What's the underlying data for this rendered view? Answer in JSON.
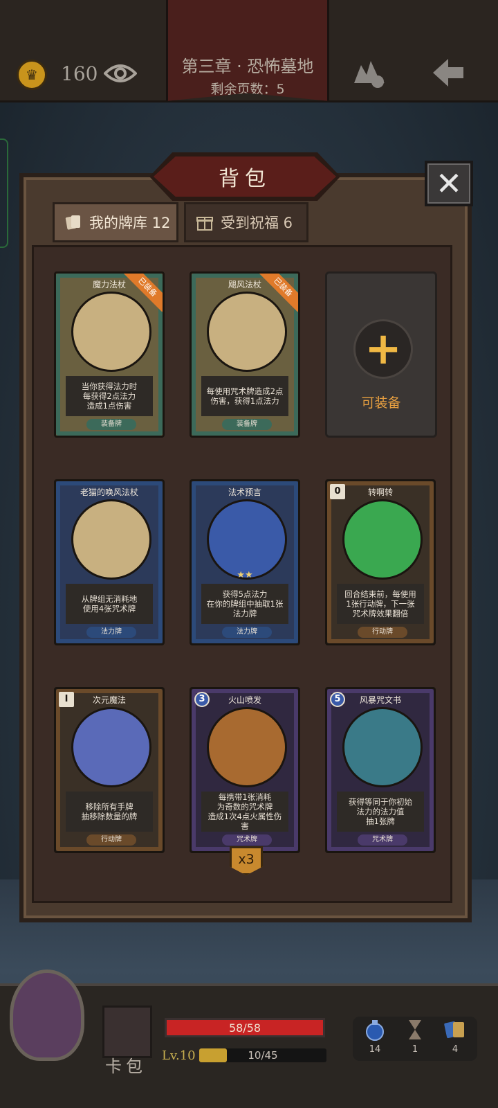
{
  "header": {
    "coins": "160",
    "chapter_title": "第三章 · 恐怖墓地",
    "pages_left": "剩余页数：5"
  },
  "panel": {
    "title": "背包",
    "close_label": "✕",
    "tabs": [
      {
        "label": "我的牌库 12",
        "active": true
      },
      {
        "label": "受到祝福 6",
        "active": false
      }
    ],
    "empty_slot_label": "可装备",
    "equipped_tag": "已装备",
    "stack_badge": "x3"
  },
  "cards": [
    {
      "name": "魔力法杖",
      "desc": "当你获得法力时\n每获得2点法力\n造成1点伤害",
      "type": "装备牌",
      "frame": "#3c6a5a",
      "art": "#c8b080",
      "equipped": true,
      "cost": ""
    },
    {
      "name": "飓风法杖",
      "desc": "每使用咒术牌造成2点\n伤害，获得1点法力",
      "type": "装备牌",
      "frame": "#3c6a5a",
      "art": "#c8b080",
      "equipped": true,
      "cost": ""
    },
    {
      "name": "老猫的唤风法杖",
      "desc": "从牌组无消耗地\n使用4张咒术牌",
      "type": "法力牌",
      "frame": "#2c4a7a",
      "art": "#c8b080",
      "equipped": false,
      "cost": ""
    },
    {
      "name": "法术预言",
      "desc": "获得5点法力\n在你的牌组中抽取1张\n法力牌",
      "type": "法力牌",
      "frame": "#2c4a7a",
      "art": "#3a5aa8",
      "equipped": false,
      "cost": "",
      "stars": "★★"
    },
    {
      "name": "转啊转",
      "desc": "回合结束前，每使用\n1张行动牌，下一张\n咒术牌效果翻倍",
      "type": "行动牌",
      "frame": "#6a4a2a",
      "art": "#3aa850",
      "equipped": false,
      "cost": "0"
    },
    {
      "name": "次元魔法",
      "desc": "移除所有手牌\n抽移除数量的牌",
      "type": "行动牌",
      "frame": "#6a4a2a",
      "art": "#5a6ab8",
      "equipped": false,
      "cost": "I"
    },
    {
      "name": "火山喷发",
      "desc": "每携带1张消耗\n为奇数的咒术牌\n造成1次4点火属性伤害",
      "type": "咒术牌",
      "frame": "#4a3a6a",
      "art": "#a86a30",
      "equipped": false,
      "cost": "3"
    },
    {
      "name": "风暴咒文书",
      "desc": "获得等同于你初始\n法力的法力值\n抽1张牌",
      "type": "咒术牌",
      "frame": "#4a3a6a",
      "art": "#3a7a88",
      "equipped": false,
      "cost": "5"
    }
  ],
  "footer": {
    "deck_label": "卡包",
    "hp_text": "58/58",
    "hp_fraction": 1.0,
    "level": "Lv.10",
    "xp_text": "10/45",
    "xp_fraction": 0.22,
    "resources": [
      {
        "icon": "potion-icon",
        "count": "14"
      },
      {
        "icon": "hourglass-icon",
        "count": "1"
      },
      {
        "icon": "cards-icon",
        "count": "4"
      }
    ]
  }
}
